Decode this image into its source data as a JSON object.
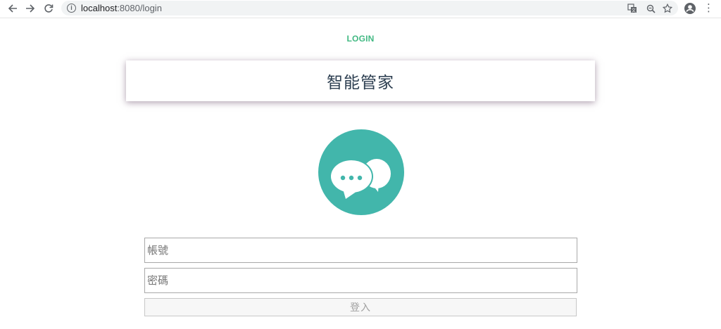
{
  "browser": {
    "url_host": "localhost",
    "url_rest": ":8080/login"
  },
  "nav": {
    "login_link": "LOGIN"
  },
  "header": {
    "title": "智能管家"
  },
  "form": {
    "account_placeholder": "帳號",
    "password_placeholder": "密碼",
    "submit_label": "登入"
  },
  "colors": {
    "accent": "#42b983",
    "logo_circle": "#42b6ab"
  },
  "icons": {
    "back": "arrow-left-icon",
    "forward": "arrow-right-icon",
    "reload": "reload-icon",
    "info": "info-icon",
    "translate": "translate-icon",
    "zoom": "zoom-icon",
    "bookmark": "star-icon",
    "profile": "account-circle-icon",
    "menu": "kebab-menu-icon",
    "logo": "chat-bubbles-icon"
  }
}
